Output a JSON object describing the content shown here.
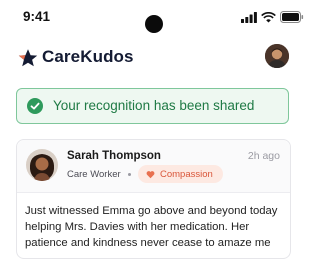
{
  "status_bar": {
    "time": "9:41"
  },
  "app": {
    "title": "CareKudos"
  },
  "toast": {
    "message": "Your recognition has been shared",
    "color": "#1f7a45"
  },
  "post": {
    "author": "Sarah Thompson",
    "time_ago": "2h ago",
    "role": "Care Worker",
    "value": "Compassion",
    "message": "Just witnessed Emma go above and beyond today helping Mrs. Davies with her medication. Her patience and kindness never cease to amaze me"
  },
  "colors": {
    "brand_navy": "#141b33",
    "success": "#2e9a5c",
    "accent": "#e8704f"
  },
  "icons": [
    "star-logo-icon",
    "signal-icon",
    "wifi-icon",
    "battery-icon",
    "check-circle-icon",
    "heart-icon"
  ]
}
